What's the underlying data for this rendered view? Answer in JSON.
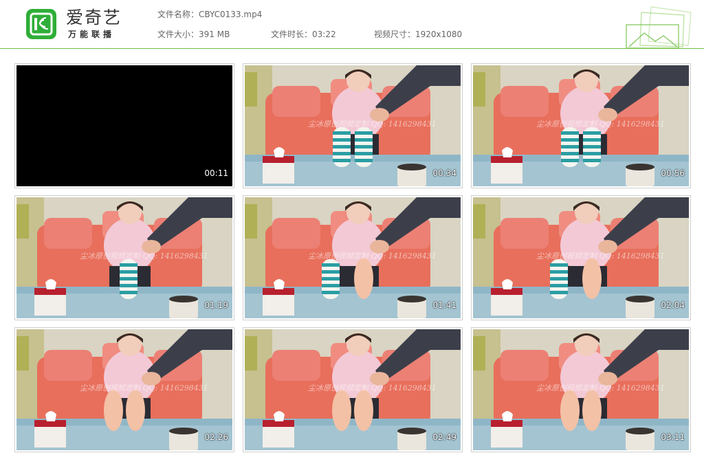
{
  "app": {
    "name": "爱奇艺",
    "slogan": "万能联播",
    "brand_color": "#2fae38"
  },
  "file_info": {
    "name_label": "文件名称：",
    "name_value": "CBYC0133.mp4",
    "size_label": "文件大小：",
    "size_value": "391 MB",
    "duration_label": "文件时长：",
    "duration_value": "03:22",
    "resolution_label": "视频尺寸：",
    "resolution_value": "1920x1080"
  },
  "watermark": {
    "text": "尘冰原创视频定制",
    "qq": "QQ: 1416298431"
  },
  "thumbnails": [
    {
      "timestamp": "00:11",
      "scene": "black"
    },
    {
      "timestamp": "00:34",
      "scene": "socks-both"
    },
    {
      "timestamp": "00:56",
      "scene": "socks-both"
    },
    {
      "timestamp": "01:19",
      "scene": "socks-one"
    },
    {
      "timestamp": "01:41",
      "scene": "sock-and-bare"
    },
    {
      "timestamp": "02:04",
      "scene": "sock-and-bare"
    },
    {
      "timestamp": "02:26",
      "scene": "bare"
    },
    {
      "timestamp": "02:49",
      "scene": "bare"
    },
    {
      "timestamp": "03:11",
      "scene": "bare"
    }
  ]
}
